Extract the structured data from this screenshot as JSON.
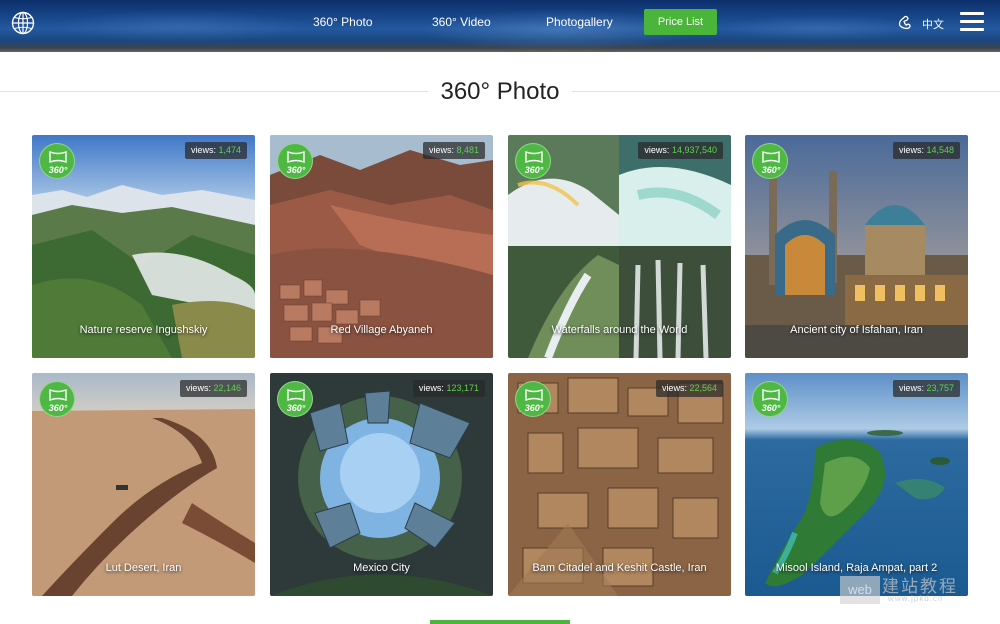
{
  "header": {
    "nav": [
      {
        "label": "360° Photo"
      },
      {
        "label": "360° Video"
      },
      {
        "label": "Photogallery"
      }
    ],
    "price_button": "Price List",
    "language": "中文",
    "icons": [
      "globe-icon",
      "phone-icon",
      "menu-icon"
    ]
  },
  "section": {
    "title": "360° Photo"
  },
  "cards": [
    {
      "title": "Nature reserve Ingushskiy",
      "views_label": "views:",
      "views": "1,474",
      "badge": "360°"
    },
    {
      "title": "Red Village Abyaneh",
      "views_label": "views:",
      "views": "8,481",
      "badge": "360°"
    },
    {
      "title": "Waterfalls around the World",
      "views_label": "views:",
      "views": "14,937,540",
      "badge": "360°"
    },
    {
      "title": "Ancient city of Isfahan, Iran",
      "views_label": "views:",
      "views": "14,548",
      "badge": "360°"
    },
    {
      "title": "Lut Desert, Iran",
      "views_label": "views:",
      "views": "22,146",
      "badge": "360°"
    },
    {
      "title": "Mexico City",
      "views_label": "views:",
      "views": "123,171",
      "badge": "360°"
    },
    {
      "title": "Bam Citadel and Keshit Castle, Iran",
      "views_label": "views:",
      "views": "22,564",
      "badge": "360°"
    },
    {
      "title": "Misool Island, Raja Ampat, part 2",
      "views_label": "views:",
      "views": "23,757",
      "badge": "360°"
    }
  ],
  "watermark": {
    "box": "web",
    "text": "建站教程",
    "url": "www.jpkd.cn"
  },
  "colors": {
    "accent": "#4bb43a",
    "views_number": "#5fd34f",
    "header": "#1a4a8f"
  }
}
